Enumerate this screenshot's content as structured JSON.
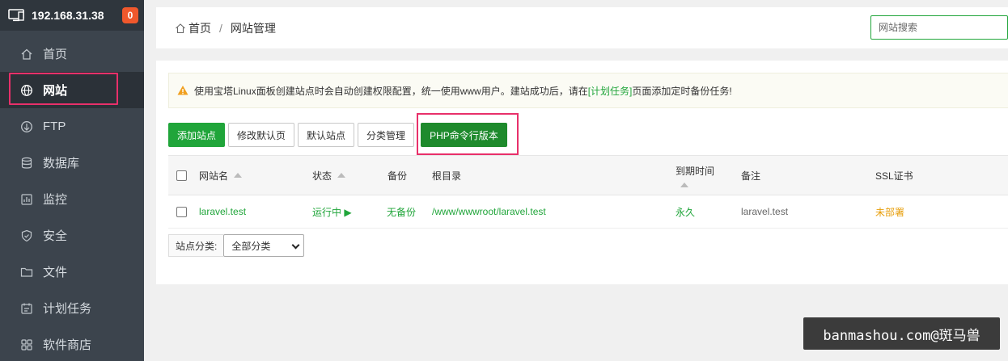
{
  "sidebar": {
    "server_ip": "192.168.31.38",
    "notification_count": "0",
    "items": [
      {
        "label": "首页",
        "icon": "home-icon"
      },
      {
        "label": "网站",
        "icon": "globe-icon"
      },
      {
        "label": "FTP",
        "icon": "ftp-icon"
      },
      {
        "label": "数据库",
        "icon": "database-icon"
      },
      {
        "label": "监控",
        "icon": "monitor-icon"
      },
      {
        "label": "安全",
        "icon": "shield-icon"
      },
      {
        "label": "文件",
        "icon": "folder-icon"
      },
      {
        "label": "计划任务",
        "icon": "calendar-icon"
      },
      {
        "label": "软件商店",
        "icon": "apps-icon"
      }
    ]
  },
  "header": {
    "breadcrumb_home": "首页",
    "breadcrumb_sep": "/",
    "breadcrumb_current": "网站管理",
    "search_placeholder": "网站搜索"
  },
  "notice": {
    "text_before": "使用宝塔Linux面板创建站点时会自动创建权限配置，统一使用www用户。建站成功后，请在",
    "link": "[计划任务]",
    "text_after": "页面添加定时备份任务!"
  },
  "toolbar": {
    "add_site": "添加站点",
    "edit_default_page": "修改默认页",
    "default_site": "默认站点",
    "category_manage": "分类管理",
    "php_cli_version": "PHP命令行版本"
  },
  "table": {
    "headers": {
      "name": "网站名",
      "status": "状态",
      "backup": "备份",
      "root": "根目录",
      "expire": "到期时间",
      "remark": "备注",
      "ssl": "SSL证书"
    },
    "rows": [
      {
        "name": "laravel.test",
        "status": "运行中 ▶",
        "backup": "无备份",
        "root": "/www/wwwroot/laravel.test",
        "expire": "永久",
        "remark": "laravel.test",
        "ssl": "未部署"
      }
    ]
  },
  "category": {
    "label": "站点分类:",
    "selected": "全部分类"
  },
  "watermark": "banmashou.com@斑马兽",
  "colors": {
    "accent_green": "#20a53a",
    "highlight_pink": "#e8306a",
    "warning_orange": "#e79e0b"
  }
}
